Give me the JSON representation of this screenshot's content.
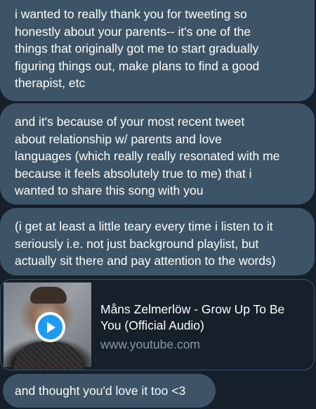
{
  "messages": [
    {
      "lines": [
        "i wanted to really thank you for tweeting so",
        "honestly about your parents-- it's one of the",
        "things that originally got me to start gradually",
        "figuring things out, make plans to find a good",
        "therapist, etc"
      ]
    },
    {
      "lines": [
        "and it's because of your most recent tweet",
        "about relationship w/ parents and love",
        "languages (which really really resonated with me",
        "because it feels absolutely true to me) that i",
        "wanted to share this song with you"
      ]
    },
    {
      "lines": [
        "(i get at least a little teary every time i listen to it",
        "seriously i.e. not just background playlist, but",
        "actually sit there and pay attention to the words)"
      ]
    }
  ],
  "link_card": {
    "title_line1": "Måns Zelmerlöw - Grow Up To Be",
    "title_line2": "You (Official Audio)",
    "domain": "www.youtube.com",
    "play_icon": "play-icon",
    "accent": "#1d9bf0"
  },
  "last_message": "and thought you'd love it too <3",
  "colors": {
    "background": "#15202b",
    "bubble": "#3d5466",
    "secondary_text": "#8899a6"
  }
}
